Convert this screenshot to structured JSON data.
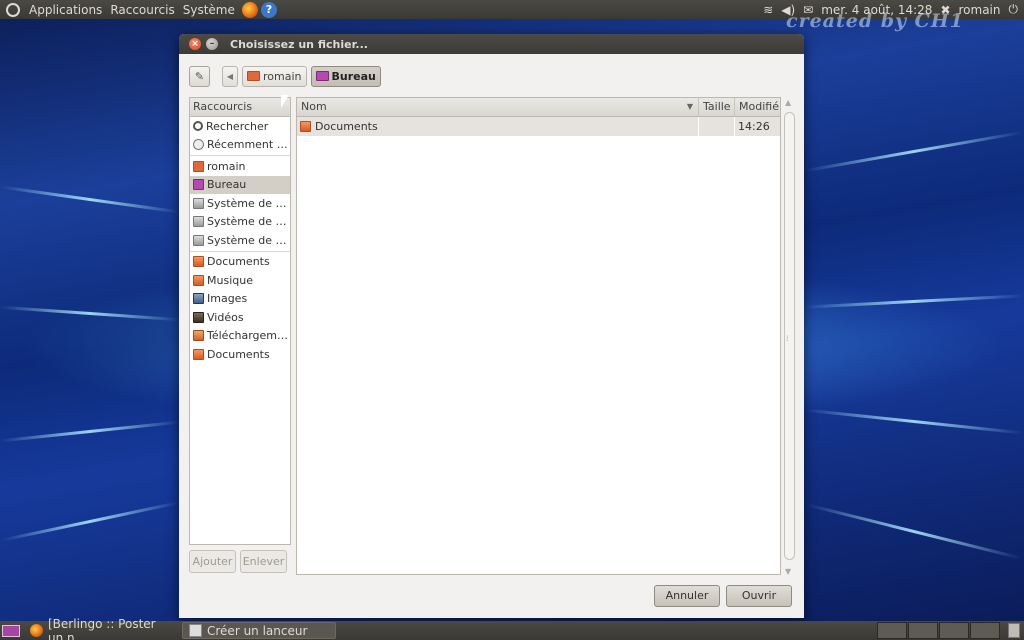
{
  "top_panel": {
    "menus": [
      "Applications",
      "Raccourcis",
      "Système"
    ],
    "datetime": "mer.  4 août, 14:28",
    "user": "romain"
  },
  "watermark": "created by CH1",
  "dialog": {
    "title": "Choisissez un fichier...",
    "breadcrumbs": [
      {
        "label": "romain",
        "icon": "home-folder-icon",
        "active": false
      },
      {
        "label": "Bureau",
        "icon": "desktop-folder-icon",
        "active": true
      }
    ],
    "places_header": "Raccourcis",
    "places": [
      {
        "label": "Rechercher",
        "icon": "search-icon"
      },
      {
        "label": "Récemment …",
        "icon": "recent-icon"
      },
      {
        "label": "romain",
        "icon": "home-folder-icon",
        "group_start": true
      },
      {
        "label": "Bureau",
        "icon": "desktop-folder-icon",
        "selected": true
      },
      {
        "label": "Système de …",
        "icon": "drive-icon"
      },
      {
        "label": "Système de …",
        "icon": "drive-icon"
      },
      {
        "label": "Système de …",
        "icon": "drive-icon"
      },
      {
        "label": "Documents",
        "icon": "documents-folder-icon",
        "group_start": true
      },
      {
        "label": "Musique",
        "icon": "music-folder-icon"
      },
      {
        "label": "Images",
        "icon": "pictures-folder-icon"
      },
      {
        "label": "Vidéos",
        "icon": "videos-folder-icon"
      },
      {
        "label": "Téléchargem…",
        "icon": "downloads-folder-icon"
      },
      {
        "label": "Documents",
        "icon": "folder-icon"
      }
    ],
    "add_button": "Ajouter",
    "remove_button": "Enlever",
    "columns": {
      "name": "Nom",
      "size": "Taille",
      "modified": "Modifié"
    },
    "files": [
      {
        "name": "Documents",
        "size": "",
        "modified": "14:26",
        "icon": "folder-icon"
      }
    ],
    "cancel_button": "Annuler",
    "open_button": "Ouvrir"
  },
  "taskbar": {
    "tasks": [
      {
        "label": "[Berlingo :: Poster un n...",
        "icon": "firefox-icon"
      },
      {
        "label": "Créer un lanceur",
        "icon": "app-icon"
      }
    ]
  }
}
